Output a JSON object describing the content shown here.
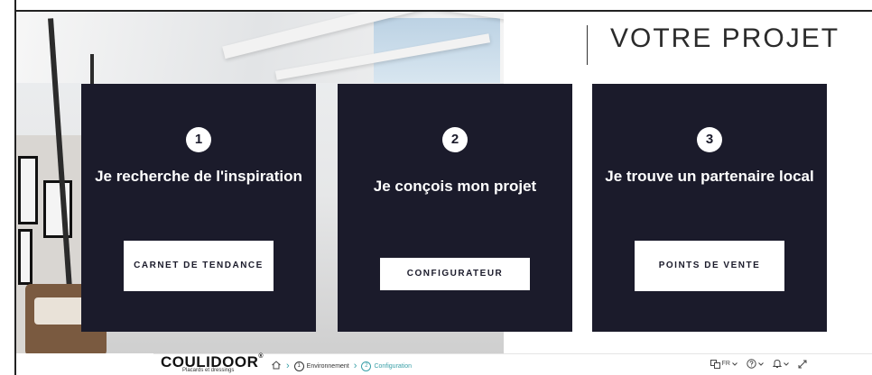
{
  "header": {
    "title": "VOTRE PROJET"
  },
  "cards": [
    {
      "number": "1",
      "title": "Je recherche de l'inspiration",
      "button_label": "CARNET DE TENDANCE"
    },
    {
      "number": "2",
      "title": "Je conçois mon projet",
      "button_label": "CONFIGURATEUR"
    },
    {
      "number": "3",
      "title": "Je trouve un partenaire local",
      "button_label": "POINTS DE VENTE"
    }
  ],
  "bottombar": {
    "brand": "COULIDOOR",
    "brand_mark": "®",
    "brand_tagline": "Placards et dressings",
    "breadcrumb": [
      {
        "number": "1",
        "label": "Environnement",
        "active": false
      },
      {
        "number": "2",
        "label": "Configuration",
        "active": true
      }
    ],
    "language": "FR",
    "icons": {
      "home": "home-icon",
      "language": "translate-icon",
      "help": "help-icon",
      "notifications": "bell-icon",
      "expand": "expand-icon"
    }
  },
  "colors": {
    "card_bg": "#1b1b2b",
    "accent": "#3aa0a8",
    "button_bg": "#ffffff"
  }
}
